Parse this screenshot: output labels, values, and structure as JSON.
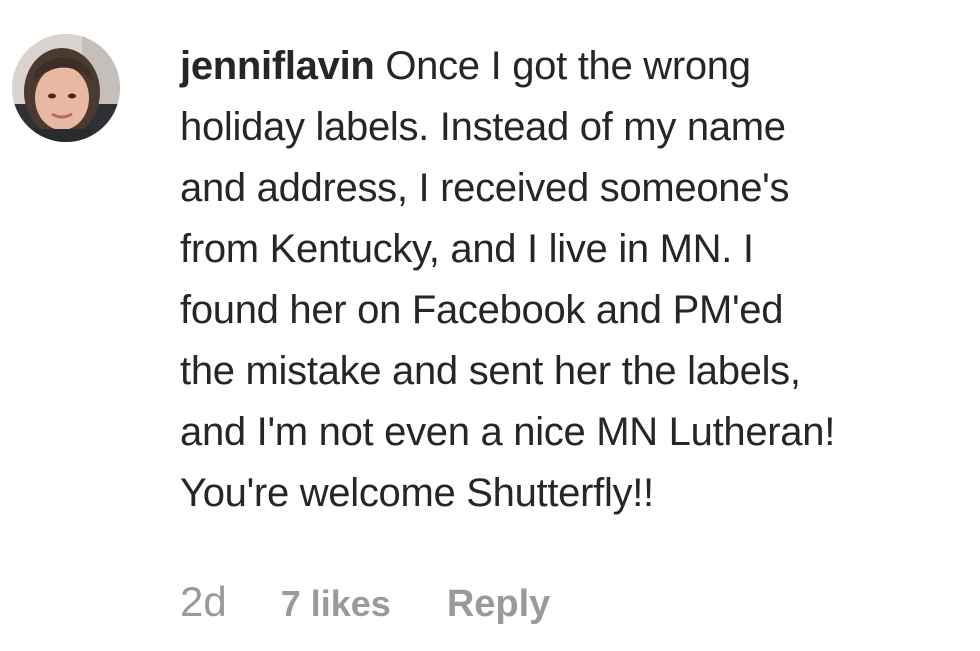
{
  "comment": {
    "username": "jenniflavin",
    "lines": [
      "Once I got the wrong",
      "holiday labels. Instead of my name",
      "and address, I received someone's",
      "from Kentucky, and I live in MN. I",
      "found her on Facebook and PM'ed",
      "the mistake and sent her the labels,",
      "and I'm not even a nice MN Lutheran!",
      "You're welcome Shutterfly!!"
    ],
    "avatar_icon": "profile-photo",
    "time": "2d",
    "likes": "7 likes",
    "reply_label": "Reply"
  }
}
